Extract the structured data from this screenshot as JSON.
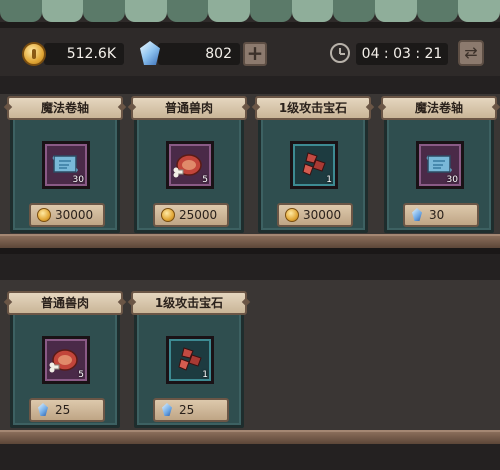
{
  "currency": {
    "gold_amount": "512.6K",
    "gem_amount": "802",
    "timer": "04 : 03 : 21"
  },
  "icons": {
    "gold": "gold-coin-icon",
    "gem": "blue-crystal-icon",
    "add": "plus-icon",
    "timer": "clock-icon",
    "refresh": "refresh-icon"
  },
  "shop": {
    "row1": [
      {
        "name": "魔法卷轴",
        "icon": "magic-scroll-icon",
        "qty": "30",
        "price": "30000",
        "currency": "gold",
        "frame": "purple"
      },
      {
        "name": "普通兽肉",
        "icon": "meat-icon",
        "qty": "5",
        "price": "25000",
        "currency": "gold",
        "frame": "purple"
      },
      {
        "name": "1级攻击宝石",
        "icon": "red-gem-icon",
        "qty": "1",
        "price": "30000",
        "currency": "gold",
        "frame": "teal"
      },
      {
        "name": "魔法卷轴",
        "icon": "magic-scroll-icon",
        "qty": "30",
        "price": "30",
        "currency": "gem",
        "frame": "purple"
      }
    ],
    "row2": [
      {
        "name": "普通兽肉",
        "icon": "meat-icon",
        "qty": "5",
        "price": "25",
        "currency": "gem",
        "frame": "purple"
      },
      {
        "name": "1级攻击宝石",
        "icon": "red-gem-icon",
        "qty": "1",
        "price": "25",
        "currency": "gem",
        "frame": "teal"
      }
    ]
  }
}
